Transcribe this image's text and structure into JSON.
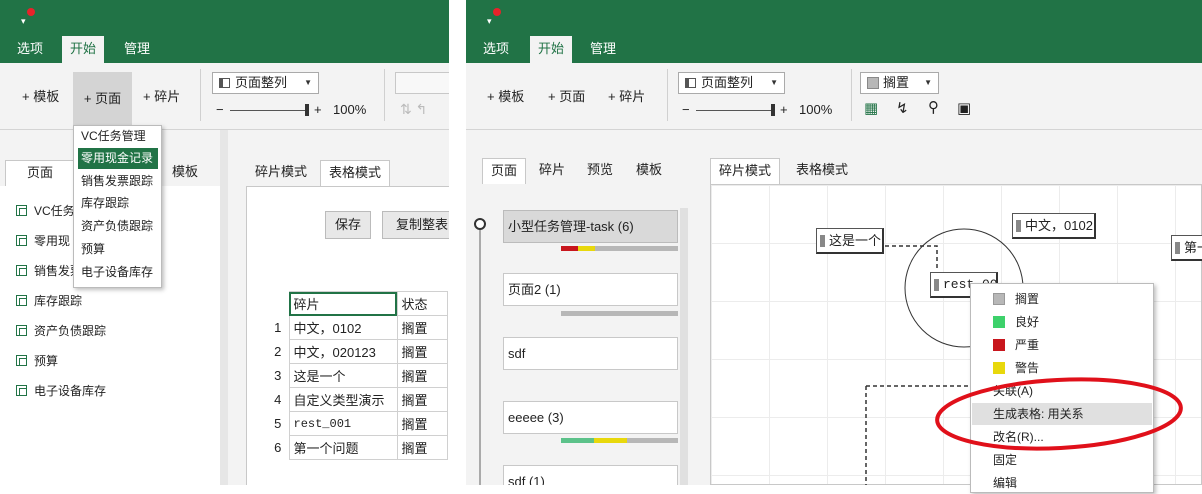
{
  "left": {
    "tabs": [
      "选项",
      "开始",
      "管理"
    ],
    "ribbon": {
      "add_template": "+ 模板",
      "add_page": "+ 页面",
      "add_fragment": "+ 碎片",
      "layout_combo": "页面整列",
      "zoom": "100%",
      "zoom_minus": "−",
      "zoom_plus": "+"
    },
    "panel_tabs": [
      "页面",
      "模板"
    ],
    "list": [
      "VC任务",
      "零用现",
      "销售发票跟踪",
      "库存跟踪",
      "资产负债跟踪",
      "预算",
      "电子设备库存"
    ],
    "dropdown": [
      "VC任务管理",
      "零用现金记录",
      "销售发票跟踪",
      "库存跟踪",
      "资产负债跟踪",
      "预算",
      "电子设备库存"
    ],
    "mode_tabs": [
      "碎片模式",
      "表格模式"
    ],
    "buttons": {
      "save": "保存",
      "copy": "复制整表"
    },
    "table": {
      "headers": [
        "碎片",
        "状态"
      ],
      "rows": [
        {
          "n": "1",
          "frag": "中文，0102",
          "status": "搁置"
        },
        {
          "n": "2",
          "frag": "中文，020123",
          "status": "搁置"
        },
        {
          "n": "3",
          "frag": "这是一个",
          "status": "搁置"
        },
        {
          "n": "4",
          "frag": "自定义类型演示",
          "status": "搁置"
        },
        {
          "n": "5",
          "frag": "rest_001",
          "status": "搁置"
        },
        {
          "n": "6",
          "frag": "第一个问题",
          "status": "搁置"
        }
      ]
    }
  },
  "right": {
    "tabs": [
      "选项",
      "开始",
      "管理"
    ],
    "ribbon": {
      "add_template": "+ 模板",
      "add_page": "+ 页面",
      "add_fragment": "+ 碎片",
      "layout_combo": "页面整列",
      "zoom": "100%",
      "zoom_minus": "−",
      "zoom_plus": "+",
      "status_combo": "搁置"
    },
    "panel_tabs": [
      "页面",
      "碎片",
      "预览",
      "模板"
    ],
    "cards": [
      {
        "label": "小型任务管理-task (6)"
      },
      {
        "label": "页面2 (1)"
      },
      {
        "label": "sdf"
      },
      {
        "label": "eeeee (3)"
      },
      {
        "label": "sdf (1)"
      }
    ],
    "mode_tabs": [
      "碎片模式",
      "表格模式"
    ],
    "nodes": [
      "这是一个",
      "中文，0102",
      "rest_001",
      "第一"
    ],
    "context_menu": [
      {
        "label": "搁置",
        "color": "#b7b7b7"
      },
      {
        "label": "良好",
        "color": "#3dd16b"
      },
      {
        "label": "严重",
        "color": "#c8161d"
      },
      {
        "label": "警告",
        "color": "#e8d80c"
      },
      {
        "label": "关联(A)"
      },
      {
        "label": "生成表格: 用关系"
      },
      {
        "label": "改名(R)..."
      },
      {
        "label": "固定"
      },
      {
        "label": "编辑"
      }
    ]
  },
  "colors": {
    "accent": "#217346",
    "annotation": "#e0101a"
  }
}
